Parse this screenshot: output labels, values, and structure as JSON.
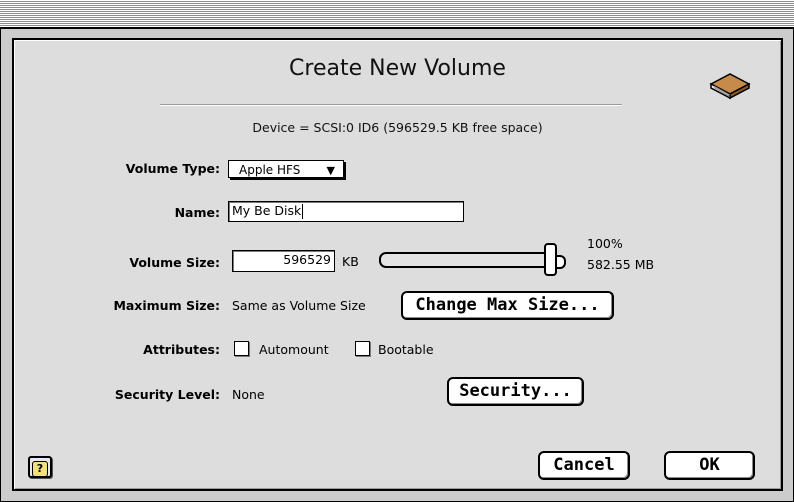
{
  "window": {
    "title": "Create New Volume"
  },
  "device": {
    "info": "Device = SCSI:0  ID6  (596529.5 KB free space)"
  },
  "fields": {
    "volume_type_label": "Volume Type:",
    "volume_type_value": "Apple HFS",
    "name_label": "Name:",
    "name_value": "My Be Disk",
    "volume_size_label": "Volume Size:",
    "volume_size_value": "596529",
    "volume_size_unit": "KB",
    "volume_percent": "100%",
    "volume_mb": "582.55 MB",
    "max_size_label": "Maximum Size:",
    "max_size_value": "Same as Volume Size",
    "attributes_label": "Attributes:",
    "automount_label": "Automount",
    "bootable_label": "Bootable",
    "security_label": "Security Level:",
    "security_value": "None"
  },
  "slider": {
    "value_fraction": 1.0
  },
  "checkboxes": {
    "automount_checked": false,
    "bootable_checked": false
  },
  "buttons": {
    "change_max_size": "Change Max Size...",
    "security": "Security...",
    "cancel": "Cancel",
    "ok": "OK",
    "help": "?"
  },
  "icons": {
    "disk": "volume-book-icon",
    "help": "help-icon",
    "popup_arrow": "triangle-down-icon"
  }
}
